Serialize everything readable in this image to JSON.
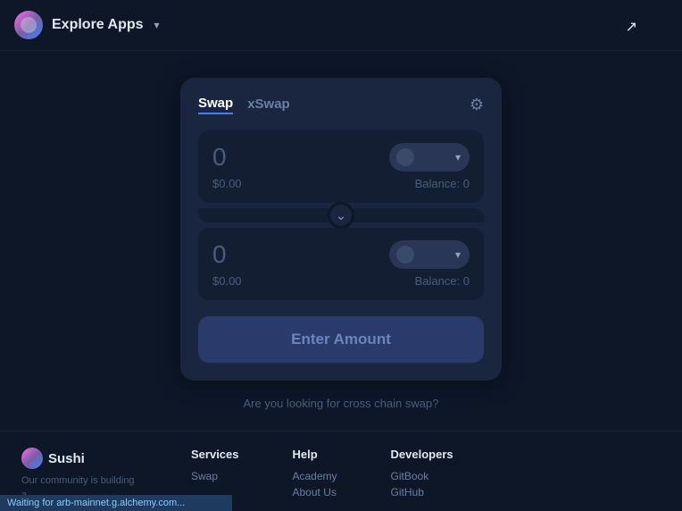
{
  "header": {
    "title": "Explore Apps",
    "chevron": "▾"
  },
  "swap_card": {
    "tab_swap": "Swap",
    "tab_xswap": "xSwap",
    "settings_icon": "⚙",
    "from_amount": "0",
    "from_usd": "$0.00",
    "from_balance": "Balance: 0",
    "to_amount": "0",
    "to_usd": "$0.00",
    "to_balance": "Balance: 0",
    "swap_arrow": "⌄",
    "enter_amount_label": "Enter Amount",
    "cross_chain_text": "Are you looking for cross chain swap?"
  },
  "footer": {
    "brand_name": "Sushi",
    "tagline": "Our community is building a",
    "services_title": "Services",
    "services_links": [
      "Swap"
    ],
    "help_title": "Help",
    "help_links": [
      "Academy",
      "About Us"
    ],
    "developers_title": "Developers",
    "developers_links": [
      "GitBook",
      "GitHub"
    ]
  },
  "status_bar": {
    "text": "Waiting for arb-mainnet.g.alchemy.com..."
  }
}
